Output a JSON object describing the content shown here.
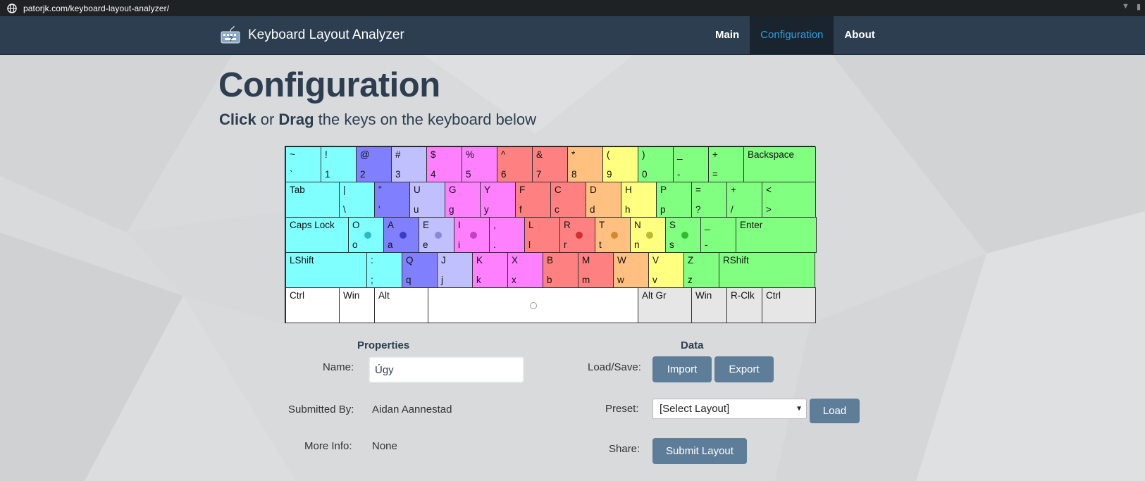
{
  "browser": {
    "url": "patorjk.com/keyboard-layout-analyzer/"
  },
  "navbar": {
    "brand": "Keyboard Layout Analyzer",
    "links": [
      "Main",
      "Configuration",
      "About"
    ],
    "active": "Configuration"
  },
  "heading": {
    "title": "Configuration",
    "subtitle_click": "Click",
    "subtitle_or": " or ",
    "subtitle_drag": "Drag",
    "subtitle_rest": " the keys on the keyboard below"
  },
  "keyboard": {
    "rows": [
      [
        {
          "top": "~",
          "bottom": "`",
          "color": "#80ffff"
        },
        {
          "top": "!",
          "bottom": "1",
          "color": "#80ffff"
        },
        {
          "top": "@",
          "bottom": "2",
          "color": "#8080ff"
        },
        {
          "top": "#",
          "bottom": "3",
          "color": "#c0c0ff"
        },
        {
          "top": "$",
          "bottom": "4",
          "color": "#ff80ff"
        },
        {
          "top": "%",
          "bottom": "5",
          "color": "#ff80ff"
        },
        {
          "top": "^",
          "bottom": "6",
          "color": "#ff8080"
        },
        {
          "top": "&",
          "bottom": "7",
          "color": "#ff8080"
        },
        {
          "top": "*",
          "bottom": "8",
          "color": "#ffc080"
        },
        {
          "top": "(",
          "bottom": "9",
          "color": "#ffff80"
        },
        {
          "top": ")",
          "bottom": "0",
          "color": "#80ff80"
        },
        {
          "top": "_",
          "bottom": "-",
          "color": "#80ff80"
        },
        {
          "top": "+",
          "bottom": "=",
          "color": "#80ff80"
        },
        {
          "top": "Backspace",
          "bottom": "",
          "color": "#80ff80"
        }
      ],
      [
        {
          "top": "Tab",
          "bottom": "",
          "color": "#80ffff"
        },
        {
          "top": "|",
          "bottom": "\\",
          "color": "#80ffff"
        },
        {
          "top": "\"",
          "bottom": "'",
          "color": "#8080ff"
        },
        {
          "top": "U",
          "bottom": "u",
          "color": "#c0c0ff"
        },
        {
          "top": "G",
          "bottom": "g",
          "color": "#ff80ff"
        },
        {
          "top": "Y",
          "bottom": "y",
          "color": "#ff80ff"
        },
        {
          "top": "F",
          "bottom": "f",
          "color": "#ff8080"
        },
        {
          "top": "C",
          "bottom": "c",
          "color": "#ff8080"
        },
        {
          "top": "D",
          "bottom": "d",
          "color": "#ffc080"
        },
        {
          "top": "H",
          "bottom": "h",
          "color": "#ffff80"
        },
        {
          "top": "P",
          "bottom": "p",
          "color": "#80ff80"
        },
        {
          "top": "=",
          "bottom": "?",
          "color": "#80ff80"
        },
        {
          "top": "+",
          "bottom": "/",
          "color": "#80ff80"
        },
        {
          "top": "<",
          "bottom": ">",
          "color": "#80ff80"
        }
      ],
      [
        {
          "top": "Caps Lock",
          "bottom": "",
          "color": "#80ffff"
        },
        {
          "top": "O",
          "bottom": "o",
          "color": "#80ffff",
          "dot": "#20b0b0"
        },
        {
          "top": "A",
          "bottom": "a",
          "color": "#8080ff",
          "dot": "#3030c0"
        },
        {
          "top": "E",
          "bottom": "e",
          "color": "#c0c0ff",
          "dot": "#8080d0"
        },
        {
          "top": "I",
          "bottom": "i",
          "color": "#ff80ff",
          "dot": "#c030c0"
        },
        {
          "top": ",",
          "bottom": ".",
          "color": "#ff80ff"
        },
        {
          "top": "L",
          "bottom": "l",
          "color": "#ff8080"
        },
        {
          "top": "R",
          "bottom": "r",
          "color": "#ff8080",
          "dot": "#d02020"
        },
        {
          "top": "T",
          "bottom": "t",
          "color": "#ffc080",
          "dot": "#d08020"
        },
        {
          "top": "N",
          "bottom": "n",
          "color": "#ffff80",
          "dot": "#b0b020"
        },
        {
          "top": "S",
          "bottom": "s",
          "color": "#80ff80",
          "dot": "#20b020"
        },
        {
          "top": "_",
          "bottom": "-",
          "color": "#80ff80"
        },
        {
          "top": "Enter",
          "bottom": "",
          "color": "#80ff80"
        }
      ],
      [
        {
          "top": "LShift",
          "bottom": "",
          "color": "#80ffff"
        },
        {
          "top": ":",
          "bottom": ";",
          "color": "#80ffff"
        },
        {
          "top": "Q",
          "bottom": "q",
          "color": "#8080ff"
        },
        {
          "top": "J",
          "bottom": "j",
          "color": "#c0c0ff"
        },
        {
          "top": "K",
          "bottom": "k",
          "color": "#ff80ff"
        },
        {
          "top": "X",
          "bottom": "x",
          "color": "#ff80ff"
        },
        {
          "top": "B",
          "bottom": "b",
          "color": "#ff8080"
        },
        {
          "top": "M",
          "bottom": "m",
          "color": "#ff8080"
        },
        {
          "top": "W",
          "bottom": "w",
          "color": "#ffc080"
        },
        {
          "top": "V",
          "bottom": "v",
          "color": "#ffff80"
        },
        {
          "top": "Z",
          "bottom": "z",
          "color": "#80ff80"
        },
        {
          "top": "RShift",
          "bottom": "",
          "color": "#80ff80"
        }
      ],
      [
        {
          "top": "Ctrl",
          "bottom": "",
          "color": "#ffffff"
        },
        {
          "top": "Win",
          "bottom": "",
          "color": "#ffffff"
        },
        {
          "top": "Alt",
          "bottom": "",
          "color": "#ffffff"
        },
        {
          "top": "",
          "bottom": "",
          "color": "#ffffff",
          "dot": "#999999"
        },
        {
          "top": "Alt Gr",
          "bottom": "",
          "color": "#e6e6e6"
        },
        {
          "top": "Win",
          "bottom": "",
          "color": "#e6e6e6"
        },
        {
          "top": "R-Clk",
          "bottom": "",
          "color": "#e6e6e6"
        },
        {
          "top": "Ctrl",
          "bottom": "",
          "color": "#e6e6e6"
        }
      ]
    ]
  },
  "properties": {
    "heading": "Properties",
    "name_label": "Name:",
    "name_value": "Úgy",
    "submitted_label": "Submitted By:",
    "submitted_value": "Aidan Aannestad",
    "more_label": "More Info:",
    "more_value": "None"
  },
  "data_panel": {
    "heading": "Data",
    "loadsave_label": "Load/Save:",
    "import_label": "Import",
    "export_label": "Export",
    "preset_label": "Preset:",
    "preset_selected": "[Select Layout]",
    "load_label": "Load",
    "share_label": "Share:",
    "submit_label": "Submit Layout"
  }
}
